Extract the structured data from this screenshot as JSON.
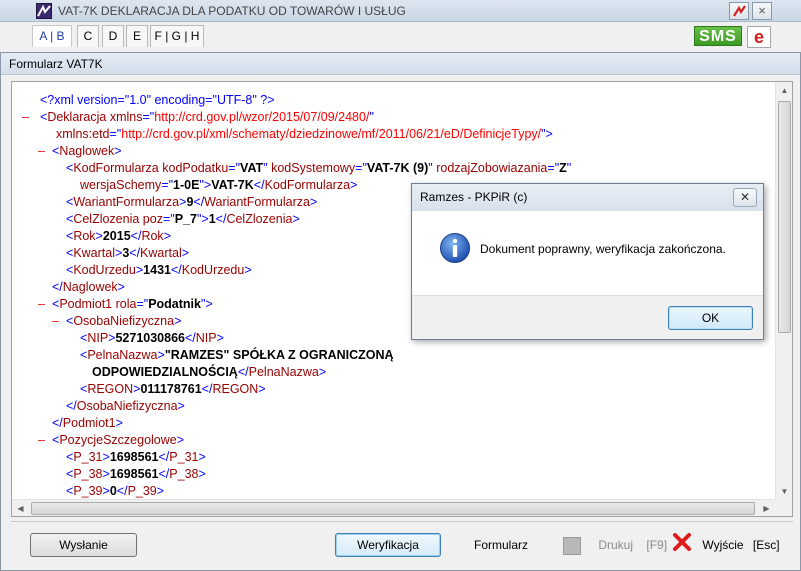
{
  "back_window": {
    "title": "VAT-7K DEKLARACJA DLA PODATKU OD TOWARÓW I USŁUG",
    "tabs": [
      {
        "label": "A | B"
      },
      {
        "label": "C"
      },
      {
        "label": "D"
      },
      {
        "label": "E"
      },
      {
        "label": "F | G | H"
      }
    ],
    "sms_label": "SMS",
    "e_label": "e",
    "close_label": "×"
  },
  "dialog": {
    "title": "Formularz VAT7K",
    "xml_lines": [
      {
        "toggle": "",
        "parts": [
          {
            "c": "b",
            "t": "<?xml version=\"1.0\" encoding=\"UTF-8\" ?>"
          }
        ]
      },
      {
        "toggle": "–",
        "parts": [
          {
            "c": "b",
            "t": "<"
          },
          {
            "c": "t",
            "t": "Deklaracja "
          },
          {
            "c": "a",
            "t": "xmlns"
          },
          {
            "c": "b",
            "t": "=\""
          },
          {
            "c": "n",
            "t": "http://crd.gov.pl/wzor/2015/07/09/2480/"
          },
          {
            "c": "b",
            "t": "\""
          }
        ]
      },
      {
        "toggle": "",
        "parts": [
          {
            "c": "a",
            "t": "xmlns:etd"
          },
          {
            "c": "b",
            "t": "=\""
          },
          {
            "c": "n",
            "t": "http://crd.gov.pl/xml/schematy/dziedzinowe/mf/2011/06/21/eD/DefinicjeTypy/"
          },
          {
            "c": "b",
            "t": "\">"
          }
        ]
      },
      {
        "toggle": "–",
        "parts": [
          {
            "c": "b",
            "t": "<"
          },
          {
            "c": "t",
            "t": "Naglowek"
          },
          {
            "c": "b",
            "t": ">"
          }
        ]
      },
      {
        "toggle": "",
        "parts": [
          {
            "c": "b",
            "t": "<"
          },
          {
            "c": "t",
            "t": "KodFormularza "
          },
          {
            "c": "a",
            "t": "kodPodatku"
          },
          {
            "c": "b",
            "t": "=\""
          },
          {
            "c": "v",
            "t": "VAT"
          },
          {
            "c": "b",
            "t": "\" "
          },
          {
            "c": "a",
            "t": "kodSystemowy"
          },
          {
            "c": "b",
            "t": "=\""
          },
          {
            "c": "v",
            "t": "VAT-7K (9)"
          },
          {
            "c": "b",
            "t": "\" "
          },
          {
            "c": "a",
            "t": "rodzajZobowiazania"
          },
          {
            "c": "b",
            "t": "=\""
          },
          {
            "c": "v",
            "t": "Z"
          },
          {
            "c": "b",
            "t": "\""
          }
        ]
      },
      {
        "toggle": "",
        "parts": [
          {
            "c": "a",
            "t": "wersjaSchemy"
          },
          {
            "c": "b",
            "t": "=\""
          },
          {
            "c": "v",
            "t": "1-0E"
          },
          {
            "c": "b",
            "t": "\">"
          },
          {
            "c": "v",
            "t": "VAT-7K"
          },
          {
            "c": "b",
            "t": "</"
          },
          {
            "c": "t",
            "t": "KodFormularza"
          },
          {
            "c": "b",
            "t": ">"
          }
        ]
      },
      {
        "toggle": "",
        "parts": [
          {
            "c": "b",
            "t": "<"
          },
          {
            "c": "t",
            "t": "WariantFormularza"
          },
          {
            "c": "b",
            "t": ">"
          },
          {
            "c": "v",
            "t": "9"
          },
          {
            "c": "b",
            "t": "</"
          },
          {
            "c": "t",
            "t": "WariantFormularza"
          },
          {
            "c": "b",
            "t": ">"
          }
        ]
      },
      {
        "toggle": "",
        "parts": [
          {
            "c": "b",
            "t": "<"
          },
          {
            "c": "t",
            "t": "CelZlozenia "
          },
          {
            "c": "a",
            "t": "poz"
          },
          {
            "c": "b",
            "t": "=\""
          },
          {
            "c": "v",
            "t": "P_7"
          },
          {
            "c": "b",
            "t": "\">"
          },
          {
            "c": "v",
            "t": "1"
          },
          {
            "c": "b",
            "t": "</"
          },
          {
            "c": "t",
            "t": "CelZlozenia"
          },
          {
            "c": "b",
            "t": ">"
          }
        ]
      },
      {
        "toggle": "",
        "parts": [
          {
            "c": "b",
            "t": "<"
          },
          {
            "c": "t",
            "t": "Rok"
          },
          {
            "c": "b",
            "t": ">"
          },
          {
            "c": "v",
            "t": "2015"
          },
          {
            "c": "b",
            "t": "</"
          },
          {
            "c": "t",
            "t": "Rok"
          },
          {
            "c": "b",
            "t": ">"
          }
        ]
      },
      {
        "toggle": "",
        "parts": [
          {
            "c": "b",
            "t": "<"
          },
          {
            "c": "t",
            "t": "Kwartal"
          },
          {
            "c": "b",
            "t": ">"
          },
          {
            "c": "v",
            "t": "3"
          },
          {
            "c": "b",
            "t": "</"
          },
          {
            "c": "t",
            "t": "Kwartal"
          },
          {
            "c": "b",
            "t": ">"
          }
        ]
      },
      {
        "toggle": "",
        "parts": [
          {
            "c": "b",
            "t": "<"
          },
          {
            "c": "t",
            "t": "KodUrzedu"
          },
          {
            "c": "b",
            "t": ">"
          },
          {
            "c": "v",
            "t": "1431"
          },
          {
            "c": "b",
            "t": "</"
          },
          {
            "c": "t",
            "t": "KodUrzedu"
          },
          {
            "c": "b",
            "t": ">"
          }
        ]
      },
      {
        "toggle": "",
        "parts": [
          {
            "c": "b",
            "t": "</"
          },
          {
            "c": "t",
            "t": "Naglowek"
          },
          {
            "c": "b",
            "t": ">"
          }
        ]
      },
      {
        "toggle": "–",
        "parts": [
          {
            "c": "b",
            "t": "<"
          },
          {
            "c": "t",
            "t": "Podmiot1 "
          },
          {
            "c": "a",
            "t": "rola"
          },
          {
            "c": "b",
            "t": "=\""
          },
          {
            "c": "v",
            "t": "Podatnik"
          },
          {
            "c": "b",
            "t": "\">"
          }
        ]
      },
      {
        "toggle": "–",
        "parts": [
          {
            "c": "b",
            "t": "<"
          },
          {
            "c": "t",
            "t": "OsobaNiefizyczna"
          },
          {
            "c": "b",
            "t": ">"
          }
        ]
      },
      {
        "toggle": "",
        "parts": [
          {
            "c": "b",
            "t": "<"
          },
          {
            "c": "t",
            "t": "NIP"
          },
          {
            "c": "b",
            "t": ">"
          },
          {
            "c": "v",
            "t": "5271030866"
          },
          {
            "c": "b",
            "t": "</"
          },
          {
            "c": "t",
            "t": "NIP"
          },
          {
            "c": "b",
            "t": ">"
          }
        ]
      },
      {
        "toggle": "",
        "parts": [
          {
            "c": "b",
            "t": "<"
          },
          {
            "c": "t",
            "t": "PelnaNazwa"
          },
          {
            "c": "b",
            "t": ">"
          },
          {
            "c": "v",
            "t": "\"RAMZES\" SPÓŁKA Z OGRANICZONĄ"
          }
        ]
      },
      {
        "toggle": "",
        "parts": [
          {
            "c": "v",
            "t": "ODPOWIEDZIALNOŚCIĄ"
          },
          {
            "c": "b",
            "t": "</"
          },
          {
            "c": "t",
            "t": "PelnaNazwa"
          },
          {
            "c": "b",
            "t": ">"
          }
        ]
      },
      {
        "toggle": "",
        "parts": [
          {
            "c": "b",
            "t": "<"
          },
          {
            "c": "t",
            "t": "REGON"
          },
          {
            "c": "b",
            "t": ">"
          },
          {
            "c": "v",
            "t": "011178761"
          },
          {
            "c": "b",
            "t": "</"
          },
          {
            "c": "t",
            "t": "REGON"
          },
          {
            "c": "b",
            "t": ">"
          }
        ]
      },
      {
        "toggle": "",
        "parts": [
          {
            "c": "b",
            "t": "</"
          },
          {
            "c": "t",
            "t": "OsobaNiefizyczna"
          },
          {
            "c": "b",
            "t": ">"
          }
        ]
      },
      {
        "toggle": "",
        "parts": [
          {
            "c": "b",
            "t": "</"
          },
          {
            "c": "t",
            "t": "Podmiot1"
          },
          {
            "c": "b",
            "t": ">"
          }
        ]
      },
      {
        "toggle": "–",
        "parts": [
          {
            "c": "b",
            "t": "<"
          },
          {
            "c": "t",
            "t": "PozycjeSzczegolowe"
          },
          {
            "c": "b",
            "t": ">"
          }
        ]
      },
      {
        "toggle": "",
        "parts": [
          {
            "c": "b",
            "t": "<"
          },
          {
            "c": "t",
            "t": "P_31"
          },
          {
            "c": "b",
            "t": ">"
          },
          {
            "c": "v",
            "t": "1698561"
          },
          {
            "c": "b",
            "t": "</"
          },
          {
            "c": "t",
            "t": "P_31"
          },
          {
            "c": "b",
            "t": ">"
          }
        ]
      },
      {
        "toggle": "",
        "parts": [
          {
            "c": "b",
            "t": "<"
          },
          {
            "c": "t",
            "t": "P_38"
          },
          {
            "c": "b",
            "t": ">"
          },
          {
            "c": "v",
            "t": "1698561"
          },
          {
            "c": "b",
            "t": "</"
          },
          {
            "c": "t",
            "t": "P_38"
          },
          {
            "c": "b",
            "t": ">"
          }
        ]
      },
      {
        "toggle": "",
        "parts": [
          {
            "c": "b",
            "t": "<"
          },
          {
            "c": "t",
            "t": "P_39"
          },
          {
            "c": "b",
            "t": ">"
          },
          {
            "c": "v",
            "t": "0"
          },
          {
            "c": "b",
            "t": "</"
          },
          {
            "c": "t",
            "t": "P_39"
          },
          {
            "c": "b",
            "t": ">"
          }
        ]
      }
    ],
    "buttons": {
      "send": "Wysłanie",
      "verify": "Weryfikacja",
      "form": "Formularz",
      "print": "Drukuj",
      "print_key": "[F9]",
      "exit": "Wyjście",
      "exit_key": "[Esc]"
    }
  },
  "message_box": {
    "title": "Ramzes - PKPiR (c)",
    "text": "Dokument poprawny, weryfikacja zakończona.",
    "ok_label": "OK",
    "close_label": "✕"
  },
  "colors": {
    "xml_markup": "#0000ff",
    "xml_tag": "#990000",
    "xml_namespace": "#ff0000",
    "toggle": "#e0161c",
    "sms": "#3d9a24",
    "exit_x": "#e01b1b"
  }
}
